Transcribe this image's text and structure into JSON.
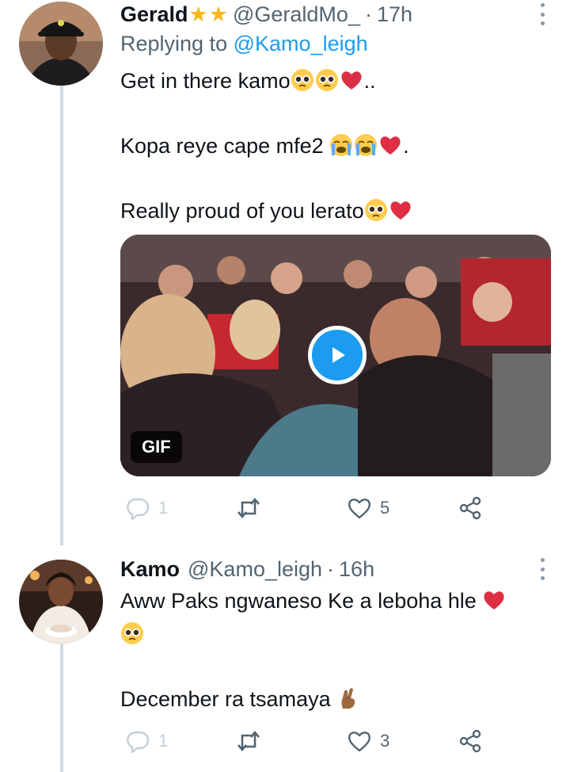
{
  "tweets": [
    {
      "name": "Gerald",
      "badges": [
        "★",
        "★"
      ],
      "handle": "@GeraldMo_",
      "time": "17h",
      "replying_prefix": "Replying to",
      "replying_to": "@Kamo_leigh",
      "paragraphs": [
        {
          "text": "Get in there kamo",
          "suffix": ".."
        },
        {
          "text": "Kopa reye cape mfe2 ",
          "suffix": "."
        },
        {
          "text": "Really proud of you lerato",
          "suffix": ""
        }
      ],
      "media": {
        "badge": "GIF"
      },
      "counts": {
        "replies": "1",
        "likes": "5"
      }
    },
    {
      "name": "Kamo",
      "handle": "@Kamo_leigh",
      "time": "16h",
      "paragraphs": [
        {
          "text": "Aww Paks ngwaneso Ke a leboha hle ",
          "suffix": ""
        },
        {
          "text": "",
          "suffix": ""
        },
        {
          "text": "December ra tsamaya ",
          "suffix": ""
        }
      ],
      "counts": {
        "replies": "1",
        "likes": "3"
      }
    }
  ],
  "separator": "·",
  "colors": {
    "link": "#1d9bf0",
    "muted": "#536471",
    "thread_line": "#cfd9de",
    "heart": "#e0245e"
  },
  "icons": [
    "reply-icon",
    "retweet-icon",
    "like-icon",
    "share-icon",
    "more-icon",
    "play-icon",
    "pleading-face-emoji",
    "red-heart-emoji",
    "crying-face-emoji",
    "crossed-fingers-emoji"
  ]
}
